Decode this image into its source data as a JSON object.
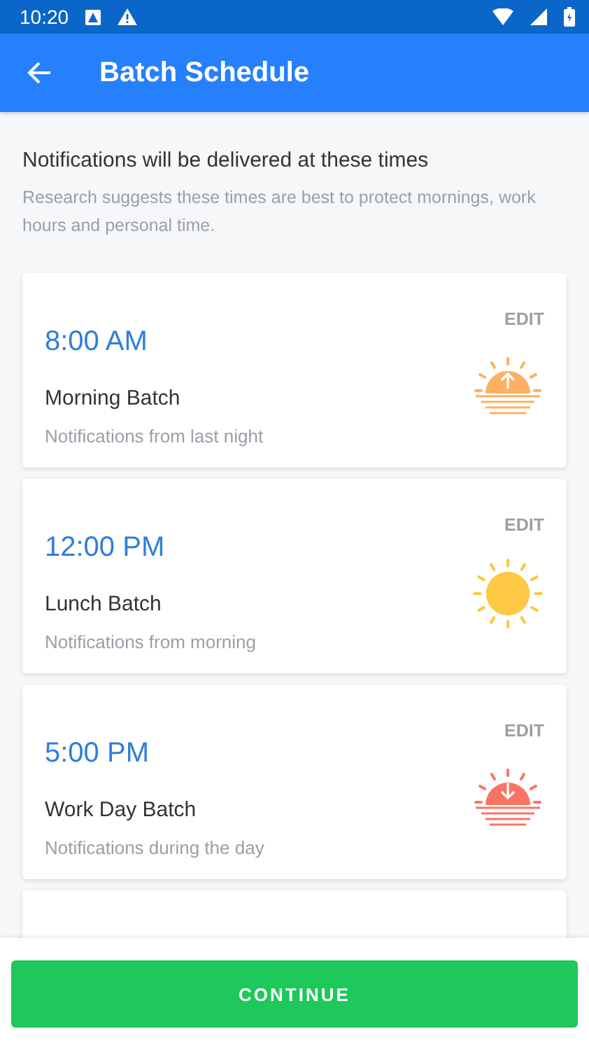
{
  "status_bar": {
    "time": "10:20"
  },
  "app_bar": {
    "title": "Batch Schedule"
  },
  "intro": {
    "heading": "Notifications will be delivered at these times",
    "text": "Research suggests these times are best to protect mornings, work hours and personal time."
  },
  "batches": [
    {
      "time": "8:00 AM",
      "name": "Morning Batch",
      "description": "Notifications from last night",
      "action": "EDIT",
      "kind": "sunrise"
    },
    {
      "time": "12:00 PM",
      "name": "Lunch Batch",
      "description": "Notifications from morning",
      "action": "EDIT",
      "kind": "sun"
    },
    {
      "time": "5:00 PM",
      "name": "Work Day Batch",
      "description": "Notifications during the day",
      "action": "EDIT",
      "kind": "sunset"
    }
  ],
  "continue_button": "CONTINUE"
}
